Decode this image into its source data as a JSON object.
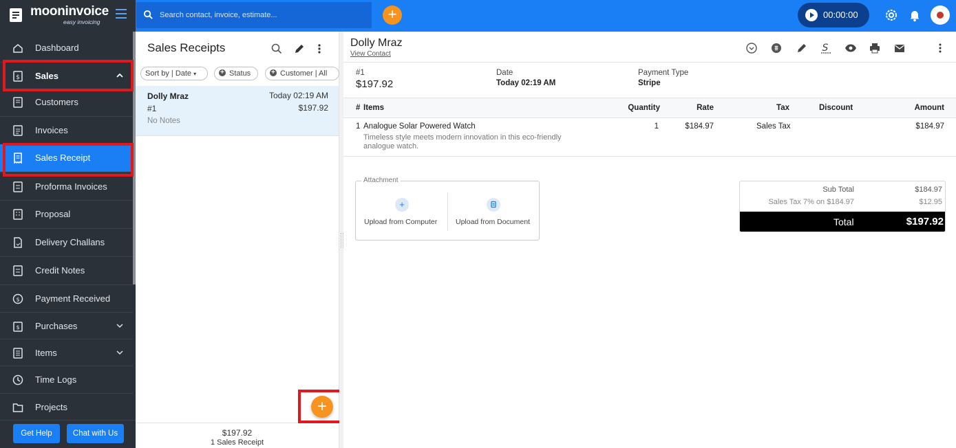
{
  "brand": {
    "name": "mooninvoice",
    "tagline": "easy invoicing"
  },
  "search": {
    "placeholder": "Search contact, invoice, estimate..."
  },
  "timer": {
    "time": "00:00:00"
  },
  "sidebar": {
    "items": [
      {
        "label": "Dashboard",
        "icon": "home-icon"
      },
      {
        "label": "Sales",
        "icon": "sales-icon",
        "expanded": true
      },
      {
        "label": "Customers",
        "icon": "customers-icon"
      },
      {
        "label": "Invoices",
        "icon": "invoice-icon"
      },
      {
        "label": "Sales Receipt",
        "icon": "receipt-icon",
        "active": true
      },
      {
        "label": "Proforma Invoices",
        "icon": "proforma-icon"
      },
      {
        "label": "Proposal",
        "icon": "proposal-icon"
      },
      {
        "label": "Delivery Challans",
        "icon": "delivery-icon"
      },
      {
        "label": "Credit Notes",
        "icon": "credit-note-icon"
      },
      {
        "label": "Payment Received",
        "icon": "payment-icon"
      },
      {
        "label": "Purchases",
        "icon": "purchases-icon"
      },
      {
        "label": "Items",
        "icon": "items-icon"
      },
      {
        "label": "Time Logs",
        "icon": "clock-icon"
      },
      {
        "label": "Projects",
        "icon": "folder-icon"
      }
    ],
    "get_help": "Get Help",
    "chat": "Chat with Us"
  },
  "list": {
    "title": "Sales Receipts",
    "filters": {
      "sort": "Sort by | Date",
      "status": "Status",
      "customer": "Customer | All"
    },
    "receipt": {
      "name": "Dolly Mraz",
      "date": "Today 02:19 AM",
      "number": "#1",
      "amount": "$197.92",
      "notes": "No Notes"
    },
    "footer": {
      "total": "$197.92",
      "count": "1 Sales Receipt"
    }
  },
  "detail": {
    "customer": "Dolly Mraz",
    "view_contact": "View Contact",
    "number": "#1",
    "total_amount": "$197.92",
    "date_label": "Date",
    "date_value": "Today 02:19 AM",
    "payment_label": "Payment Type",
    "payment_value": "Stripe",
    "columns": {
      "num": "#",
      "items": "Items",
      "qty": "Quantity",
      "rate": "Rate",
      "tax": "Tax",
      "discount": "Discount",
      "amount": "Amount"
    },
    "line": {
      "index": "1",
      "name": "Analogue Solar Powered Watch",
      "desc": "Timeless style meets modern innovation in this eco-friendly analogue watch.",
      "qty": "1",
      "rate": "$184.97",
      "tax": "Sales Tax",
      "discount": "",
      "amount": "$184.97"
    },
    "attachment": {
      "label": "Attachment",
      "computer": "Upload from Computer",
      "document": "Upload from Document"
    },
    "totals": {
      "subtotal_label": "Sub Total",
      "subtotal_value": "$184.97",
      "tax_label": "Sales Tax 7% on $184.97",
      "tax_value": "$12.95",
      "total_label": "Total",
      "total_value": "$197.92"
    }
  },
  "colors": {
    "brand_blue": "#1a7ef5",
    "sidebar": "#2a3139",
    "accent_orange": "#f7931e",
    "highlight_red": "#e0191f"
  }
}
